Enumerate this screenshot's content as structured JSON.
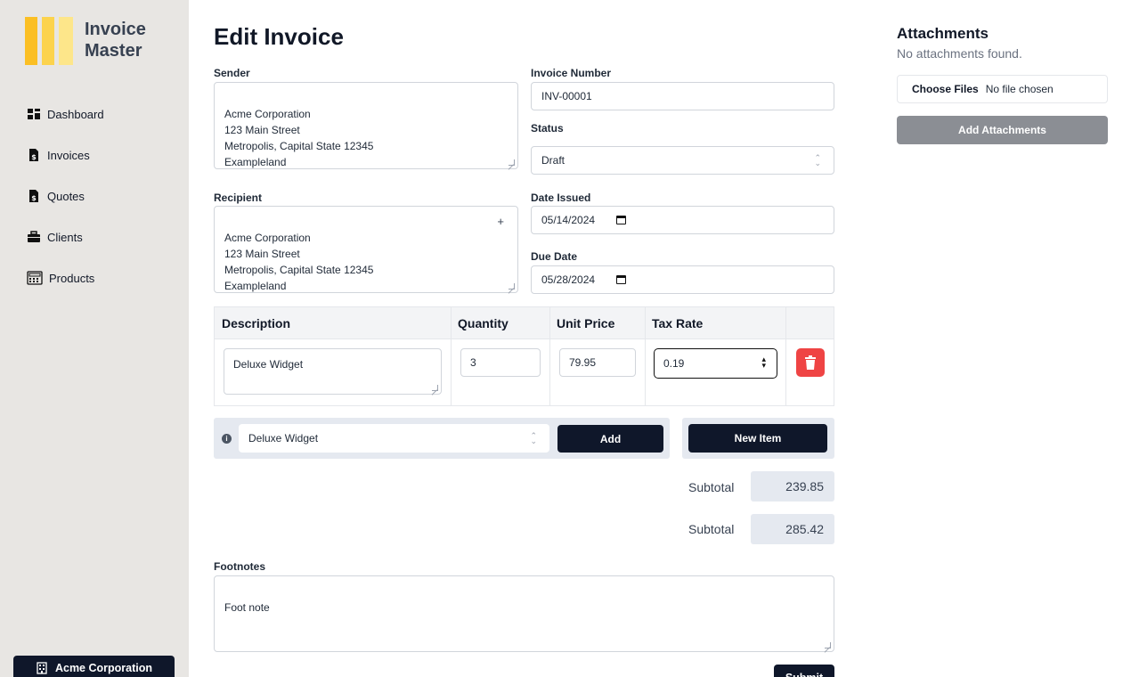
{
  "app": {
    "name_line1": "Invoice",
    "name_line2": "Master"
  },
  "sidebar": {
    "items": [
      {
        "label": "Dashboard",
        "icon": "dashboard-icon"
      },
      {
        "label": "Invoices",
        "icon": "invoice-file-icon"
      },
      {
        "label": "Quotes",
        "icon": "quote-file-icon"
      },
      {
        "label": "Clients",
        "icon": "briefcase-icon"
      },
      {
        "label": "Products",
        "icon": "calculator-icon"
      }
    ],
    "company": "Acme Corporation"
  },
  "page": {
    "title": "Edit Invoice"
  },
  "form": {
    "sender_label": "Sender",
    "sender_value": "Acme Corporation\n123 Main Street\nMetropolis, Capital State 12345\nExampleland",
    "recipient_label": "Recipient",
    "recipient_value": "Acme Corporation\n123 Main Street\nMetropolis, Capital State 12345\nExampleland",
    "recipient_plus": "+",
    "invoice_number_label": "Invoice Number",
    "invoice_number_value": "INV-00001",
    "status_label": "Status",
    "status_value": "Draft",
    "date_issued_label": "Date Issued",
    "date_issued_value": "05/14/2024",
    "due_date_label": "Due Date",
    "due_date_value": "05/28/2024"
  },
  "items_table": {
    "headers": [
      "Description",
      "Quantity",
      "Unit Price",
      "Tax Rate"
    ],
    "rows": [
      {
        "description": "Deluxe Widget",
        "quantity": "3",
        "unit_price": "79.95",
        "tax_rate": "0.19"
      }
    ]
  },
  "add_item": {
    "info": "i",
    "selected_product": "Deluxe Widget",
    "add_label": "Add",
    "new_item_label": "New Item"
  },
  "totals": [
    {
      "label": "Subtotal",
      "value": "239.85"
    },
    {
      "label": "Subtotal",
      "value": "285.42"
    }
  ],
  "footnotes": {
    "label": "Footnotes",
    "value": "Foot note"
  },
  "attachments": {
    "title": "Attachments",
    "empty_text": "No attachments found.",
    "choose_label": "Choose Files",
    "no_file_label": "No file chosen",
    "add_label": "Add Attachments"
  },
  "submit_label": "Submit",
  "colors": {
    "sidebar_bg": "#e8e6e3",
    "primary_dark": "#0f172a",
    "danger": "#ef4444",
    "logo_yellow": "#fbbf24",
    "panel_bg": "#e5e9f0",
    "disabled_btn": "#8b8e94"
  }
}
